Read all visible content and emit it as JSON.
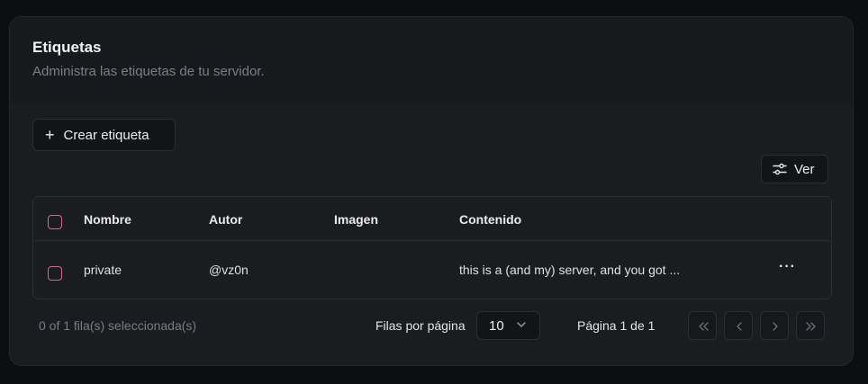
{
  "header": {
    "title": "Etiquetas",
    "subtitle": "Administra las etiquetas de tu servidor."
  },
  "toolbar": {
    "create_label": "Crear etiqueta",
    "view_label": "Ver"
  },
  "table": {
    "columns": [
      "Nombre",
      "Autor",
      "Imagen",
      "Contenido"
    ],
    "rows": [
      {
        "nombre": "private",
        "autor": "@vz0n",
        "imagen": "",
        "contenido": "this is a (and my) server, and you got ..."
      }
    ]
  },
  "footer": {
    "selection": "0 of 1 fila(s) seleccionada(s)",
    "rows_per_page_label": "Filas por página",
    "rows_per_page_value": "10",
    "page_label": "Página 1 de 1"
  },
  "colors": {
    "background": "#0d0e11",
    "card": "#1b1c20",
    "checkbox_accent": "#d4698c"
  },
  "icons": {
    "create": "plus-icon",
    "view": "sliders-icon",
    "select": "chevron-down-icon",
    "row_actions": "more-horizontal-icon",
    "first": "chevrons-left-icon",
    "prev": "chevron-left-icon",
    "next": "chevron-right-icon",
    "last": "chevrons-right-icon"
  }
}
